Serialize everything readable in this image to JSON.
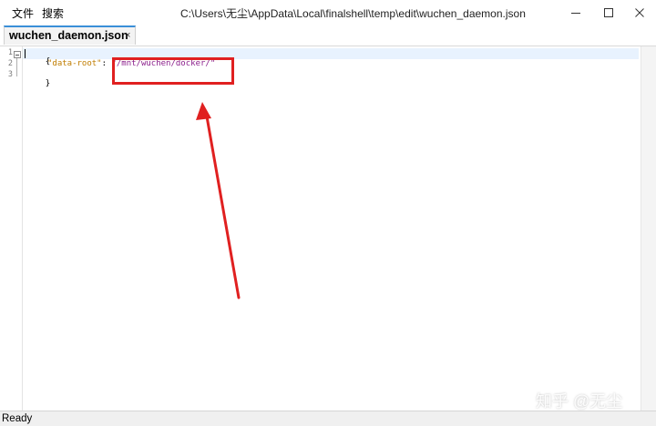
{
  "menu": {
    "file": "文件",
    "search": "搜索"
  },
  "window": {
    "title": "C:\\Users\\无尘\\AppData\\Local\\finalshell\\temp\\edit\\wuchen_daemon.json"
  },
  "tabs": [
    {
      "label": "wuchen_daemon.json",
      "close": "×"
    }
  ],
  "editor": {
    "line_numbers": [
      "1",
      "2",
      "3"
    ],
    "lines": {
      "open_brace": "{",
      "key": "\"data-root\"",
      "colon": ": ",
      "value": "\"/mnt/wuchen/docker/\"",
      "close_brace": "}"
    }
  },
  "status": {
    "text": "Ready"
  },
  "watermark": "知乎 @无尘",
  "colors": {
    "annotation": "#e02020",
    "key": "#c07d00",
    "string": "#8b1e8b"
  }
}
